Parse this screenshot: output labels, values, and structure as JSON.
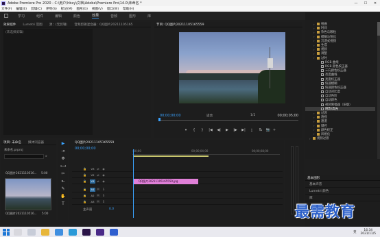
{
  "titlebar": {
    "title": "Adobe Premiere Pro 2020 - C:\\用户\\hbxy\\文档\\Adobe\\Premiere Pro\\14.0\\未命名 *",
    "minimize": "—",
    "maximize": "☐",
    "close": "✕"
  },
  "menu": [
    "文件(F)",
    "编辑(E)",
    "剪辑(C)",
    "序列(S)",
    "标记(M)",
    "图形(G)",
    "视图(V)",
    "窗口(W)",
    "帮助(H)"
  ],
  "workspaces": [
    "学习",
    "组件",
    "编辑",
    "颜色",
    "效果",
    "音频",
    "图形",
    "库"
  ],
  "active_workspace": "效果",
  "effect_controls": {
    "tabs": [
      "效果控件",
      "Lumetri 范围",
      "源：(无剪辑)",
      "音频剪辑混合器：QQ图片20211105165"
    ],
    "empty_label": "(未选择剪辑)"
  },
  "program": {
    "tab": "节目: QQ图片20211105165559",
    "timecode_left": "00;00;00;00",
    "fit": "适合",
    "ratio": "1/2",
    "timecode_right": "00;00;05;00",
    "transport": [
      "▾",
      "{",
      "}",
      "|◀",
      "◀|",
      "▶",
      "|▶",
      "▶|",
      "⤓",
      "⤒",
      "📷"
    ],
    "transport_right": [
      "⇆",
      "⬚",
      "+"
    ]
  },
  "effects": {
    "items": [
      {
        "label": "扭曲",
        "kind": "folder",
        "indent": 2,
        "selected": false
      },
      {
        "label": "时间",
        "kind": "folder",
        "indent": 2,
        "selected": false
      },
      {
        "label": "杂色与颗粒",
        "kind": "folder",
        "indent": 2,
        "selected": false
      },
      {
        "label": "模糊与锐化",
        "kind": "folder",
        "indent": 2,
        "selected": false
      },
      {
        "label": "沉浸式视频",
        "kind": "folder",
        "indent": 2,
        "selected": false
      },
      {
        "label": "生成",
        "kind": "folder",
        "indent": 2,
        "selected": false
      },
      {
        "label": "视频",
        "kind": "folder",
        "indent": 2,
        "selected": false
      },
      {
        "label": "调整",
        "kind": "folder",
        "indent": 2,
        "selected": false
      },
      {
        "label": "过时",
        "kind": "folder",
        "indent": 2,
        "selected": false
      },
      {
        "label": "RGB 曲线",
        "kind": "file",
        "indent": 3,
        "selected": false
      },
      {
        "label": "RGB 颜色校正器",
        "kind": "file",
        "indent": 3,
        "selected": false
      },
      {
        "label": "三向颜色校正器",
        "kind": "file",
        "indent": 3,
        "selected": false
      },
      {
        "label": "亮度曲线",
        "kind": "file",
        "indent": 3,
        "selected": false
      },
      {
        "label": "亮度校正器",
        "kind": "file",
        "indent": 3,
        "selected": false
      },
      {
        "label": "快速模糊",
        "kind": "file",
        "indent": 3,
        "selected": false
      },
      {
        "label": "快速颜色校正器",
        "kind": "file",
        "indent": 3,
        "selected": false
      },
      {
        "label": "自动对比度",
        "kind": "file",
        "indent": 3,
        "selected": false
      },
      {
        "label": "自动色阶",
        "kind": "file",
        "indent": 3,
        "selected": false
      },
      {
        "label": "自动颜色",
        "kind": "file",
        "indent": 3,
        "selected": false
      },
      {
        "label": "视频限幅器（旧版）",
        "kind": "file",
        "indent": 3,
        "selected": false
      },
      {
        "label": "阴影/高光",
        "kind": "file",
        "indent": 3,
        "selected": true
      },
      {
        "label": "过渡",
        "kind": "folder",
        "indent": 2,
        "selected": false
      },
      {
        "label": "透视",
        "kind": "folder",
        "indent": 2,
        "selected": false
      },
      {
        "label": "通道",
        "kind": "folder",
        "indent": 2,
        "selected": false
      },
      {
        "label": "键控",
        "kind": "folder",
        "indent": 2,
        "selected": false
      },
      {
        "label": "颜色校正",
        "kind": "folder",
        "indent": 2,
        "selected": false
      },
      {
        "label": "风格化",
        "kind": "folder",
        "indent": 2,
        "selected": false
      },
      {
        "label": "视频过渡",
        "kind": "folder",
        "indent": 1,
        "selected": false
      }
    ]
  },
  "essential_graphics": {
    "title": "基本图形",
    "rows": [
      "基本声音",
      "Lumetri 颜色",
      "库"
    ]
  },
  "project": {
    "tabs": [
      "项目: 未命名",
      "媒体浏览器"
    ],
    "file": "未命名.prproj",
    "list_clip": "QQ图片2021110516...",
    "list_duration": "5:00",
    "thumb_name": "QQ图片2021110516...",
    "thumb_duration": "5:00"
  },
  "tools": [
    "▶",
    "⇥",
    "✥",
    "⟷",
    "✂",
    "⇤",
    "✎",
    "✋",
    "T"
  ],
  "timeline": {
    "tab": "QQ图片20211105165559",
    "timecode": "00;00;00;00",
    "ruler": [
      ":00;00",
      "00;00;04;00",
      "00;00;08;00"
    ],
    "tracks": [
      "V3",
      "V2",
      "V1",
      "A1",
      "A2",
      "A3"
    ],
    "clip": "QQ图片20211105165559.jpg",
    "master_label": "主声道",
    "master_value": "0.0"
  },
  "taskbar": {
    "lang": "英",
    "time": "16:34",
    "date": "2021/11/5"
  },
  "watermark": "最需教育"
}
